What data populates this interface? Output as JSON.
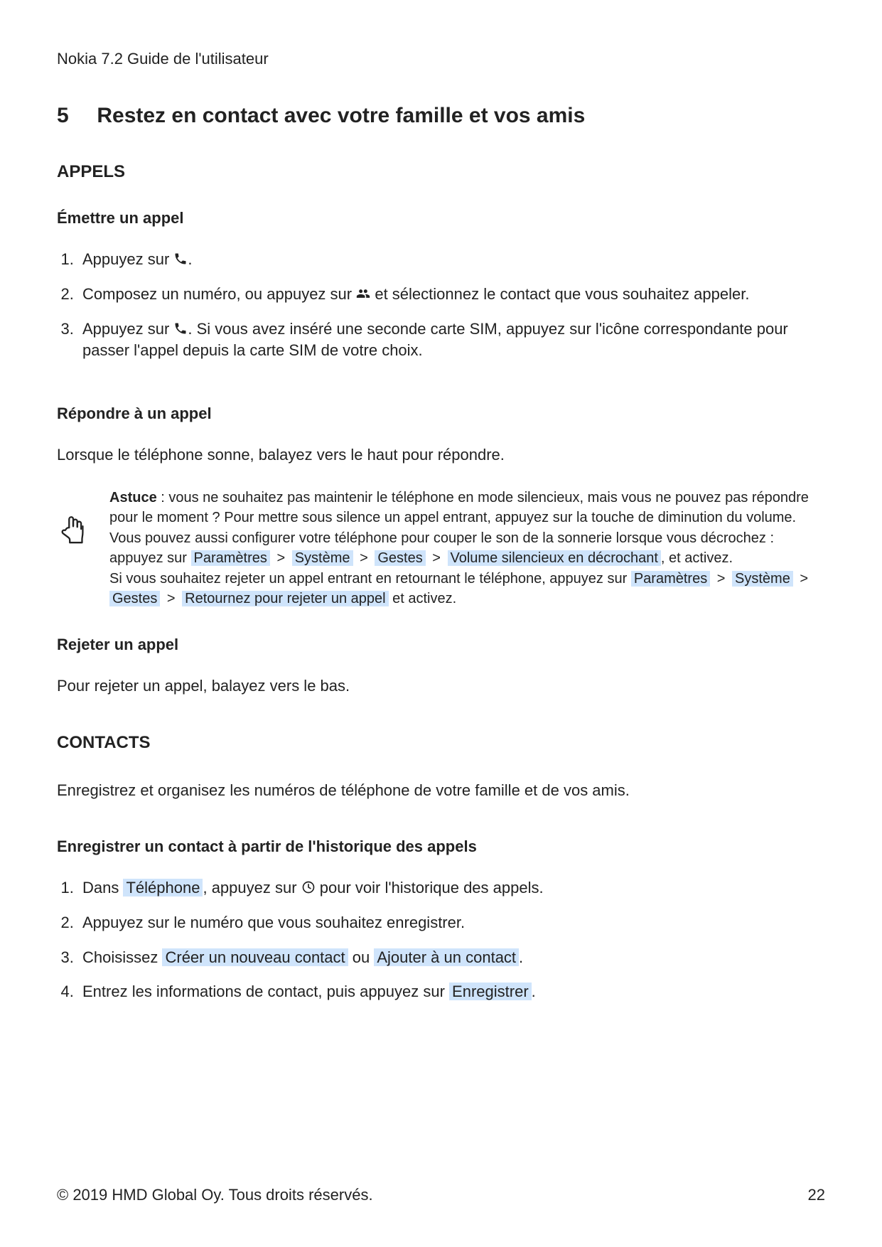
{
  "document_title": "Nokia 7.2 Guide de l'utilisateur",
  "chapter_number": "5",
  "chapter_title": "Restez en contact avec votre famille et vos amis",
  "h2_appels": "APPELS",
  "h3_emettre": "Émettre un appel",
  "steps_emettre": {
    "s1_a": "Appuyez sur ",
    "s1_b": ".",
    "s2_a": "Composez un numéro, ou appuyez sur ",
    "s2_b": " et sélectionnez le contact que vous souhaitez appeler.",
    "s3_a": "Appuyez sur ",
    "s3_b": ". Si vous avez inséré une seconde carte SIM, appuyez sur l'icône correspondante pour passer l'appel depuis la carte SIM de votre choix."
  },
  "h3_repondre": "Répondre à un appel",
  "repondre_body": "Lorsque le téléphone sonne, balayez vers le haut pour répondre.",
  "tip": {
    "bold": "Astuce",
    "t1": " : vous ne souhaitez pas maintenir le téléphone en mode silencieux, mais vous ne pouvez pas répondre pour le moment ? Pour mettre sous silence un appel entrant, appuyez sur la touche de diminution du volume. Vous pouvez aussi configurer votre téléphone pour couper le son de la sonnerie lorsque vous décrochez : appuyez sur ",
    "hl_parametres": "Paramètres",
    "hl_systeme": "Système",
    "hl_gestes": "Gestes",
    "hl_volume_silencieux": "Volume silencieux en décrochant",
    "t2": ", et activez.",
    "t3": "Si vous souhaitez rejeter un appel entrant en retournant le téléphone, appuyez sur ",
    "hl_retournez": "Retournez pour rejeter un appel",
    "t4": " et activez."
  },
  "h3_rejeter": "Rejeter un appel",
  "rejeter_body": "Pour rejeter un appel, balayez vers le bas.",
  "h2_contacts": "CONTACTS",
  "contacts_intro": "Enregistrez et organisez les numéros de téléphone de votre famille et de vos amis.",
  "h3_enregistrer": "Enregistrer un contact à partir de l'historique des appels",
  "steps_enreg": {
    "s1_a": "Dans ",
    "s1_hl_telephone": "Téléphone",
    "s1_b": ", appuyez sur ",
    "s1_c": " pour voir l'historique des appels.",
    "s2": "Appuyez sur le numéro que vous souhaitez enregistrer.",
    "s3_a": "Choisissez ",
    "s3_hl_creer": "Créer un nouveau contact",
    "s3_ou": " ou ",
    "s3_hl_ajouter": "Ajouter à un contact",
    "s3_b": ".",
    "s4_a": "Entrez les informations de contact, puis appuyez sur ",
    "s4_hl_enregistrer": "Enregistrer",
    "s4_b": "."
  },
  "gt": ">",
  "footer_left": "© 2019 HMD Global Oy. Tous droits réservés.",
  "footer_right": "22"
}
